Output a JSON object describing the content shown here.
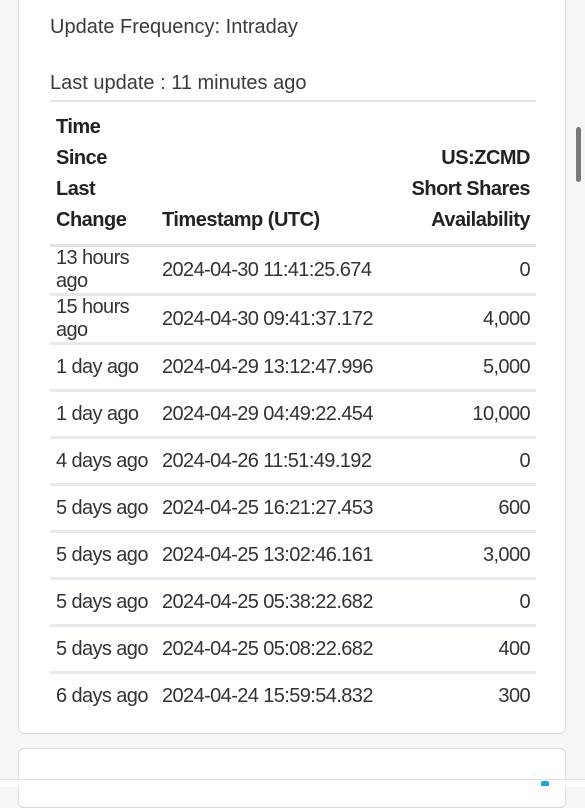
{
  "update_frequency": "Update Frequency: Intraday",
  "last_update": "Last update : 11 minutes ago",
  "table": {
    "headers": {
      "time_since": "Time Since Last Change",
      "timestamp": "Timestamp (UTC)",
      "availability": "US:ZCMD Short Shares Availability"
    },
    "rows": [
      {
        "time_since": "13 hours ago",
        "timestamp": "2024-04-30 11:41:25.674",
        "availability": "0"
      },
      {
        "time_since": "15 hours ago",
        "timestamp": "2024-04-30 09:41:37.172",
        "availability": "4,000"
      },
      {
        "time_since": "1 day ago",
        "timestamp": "2024-04-29 13:12:47.996",
        "availability": "5,000"
      },
      {
        "time_since": "1 day ago",
        "timestamp": "2024-04-29 04:49:22.454",
        "availability": "10,000"
      },
      {
        "time_since": "4 days ago",
        "timestamp": "2024-04-26 11:51:49.192",
        "availability": "0"
      },
      {
        "time_since": "5 days ago",
        "timestamp": "2024-04-25 16:21:27.453",
        "availability": "600"
      },
      {
        "time_since": "5 days ago",
        "timestamp": "2024-04-25 13:02:46.161",
        "availability": "3,000"
      },
      {
        "time_since": "5 days ago",
        "timestamp": "2024-04-25 05:38:22.682",
        "availability": "0"
      },
      {
        "time_since": "5 days ago",
        "timestamp": "2024-04-25 05:08:22.682",
        "availability": "400"
      },
      {
        "time_since": "6 days ago",
        "timestamp": "2024-04-24 15:59:54.832",
        "availability": "300"
      }
    ]
  },
  "colors": {
    "background": "#f6f6f6",
    "card": "#ffffff",
    "divider": "#e3e5ea",
    "accent": "#19a6d6"
  }
}
